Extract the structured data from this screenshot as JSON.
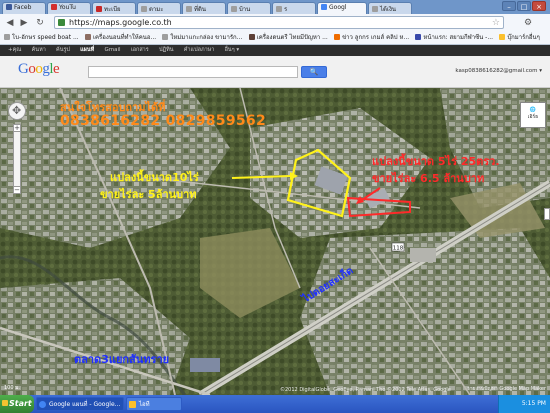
{
  "browser": {
    "tabs": [
      {
        "label": "Faceb",
        "color": "#3b5998"
      },
      {
        "label": "YouTu",
        "color": "#d32f2f"
      },
      {
        "label": "ทะเบีย",
        "color": "#c62828"
      },
      {
        "label": "ตามะ",
        "color": "#9e9e9e"
      },
      {
        "label": "ที่ดิน",
        "color": "#9e9e9e"
      },
      {
        "label": "บ้าน",
        "color": "#9e9e9e"
      },
      {
        "label": "ร",
        "color": "#9e9e9e"
      },
      {
        "label": "Googl",
        "color": "#4285f4"
      },
      {
        "label": "ได้เงิน",
        "color": "#9e9e9e"
      }
    ],
    "url": "https://maps.google.co.th",
    "bookmarks": [
      {
        "label": "โบ-อักษร speed boat ...",
        "color": "#9e9e9e"
      },
      {
        "label": "เครื่องนอนที่ทำให้คนอ...",
        "color": "#8d6e63"
      },
      {
        "label": "ใหม่มาแกะกล่อง ขามารัก...",
        "color": "#9e9e9e"
      },
      {
        "label": "เครื่องดนตรี ไทยมีปัญหา ...",
        "color": "#5d4037"
      },
      {
        "label": "ข่าว ลูกกร เกมส์ คลิป ห...",
        "color": "#ef6c00"
      },
      {
        "label": "หน้าแรก: สยามกีฬาซีน -...",
        "color": "#3949ab"
      },
      {
        "label": "บุ๊กมาร์กอื่นๆ",
        "color": "#fbc02d"
      }
    ]
  },
  "gbar": {
    "items": [
      "+คุณ",
      "ค้นหา",
      "ค้นรูป",
      "แผนที่",
      "Gmail",
      "เอกสาร",
      "ปฏิทิน",
      "คำแปลภาษา",
      "อื่นๆ ▾"
    ],
    "active_index": 3
  },
  "maps": {
    "logo": "Google",
    "user": "kasp0838616282@gmail.com ▾",
    "map_type_label": "เอิร์ธ",
    "scale": "100 ม.",
    "copyright": "©2012 DigitalGlobe, GeoEye, Ramani Tho ©2012 Tele Atlas, Google",
    "feedback": "รายงานปัญหา  Google Map Maker"
  },
  "overlay": {
    "phone_label": "สนใจโทรสอบถามได้ที่",
    "phones": "0838616282 0829859562",
    "plot10_line1": "แปลงนี้ขนาด10ไร่",
    "plot10_line2": "ขายไร่ละ 5ล้านบาท",
    "plot5_line1": "แปลงนี้ขนาด 5ไร่ 25ตรว.",
    "plot5_line2": "ขายไร่ละ 6.5 ล้านบาท",
    "road_label": "ไปดอยสะเก็ด",
    "market_label": "ตลาด3แยกสันทราย",
    "road_marker": "118"
  },
  "taskbar": {
    "start": "Start",
    "items": [
      {
        "label": "Google แผนที่ - Google...",
        "color": "#4285f4",
        "active": true
      },
      {
        "label": "ไอที",
        "color": "#fbc02d",
        "active": false
      }
    ],
    "clock": "5:15 PM"
  },
  "colors": {
    "overlay_orange": "#ff8a1a",
    "overlay_yellow": "#fff21a",
    "overlay_red": "#ff2a2a",
    "overlay_blue": "#2030ff"
  }
}
